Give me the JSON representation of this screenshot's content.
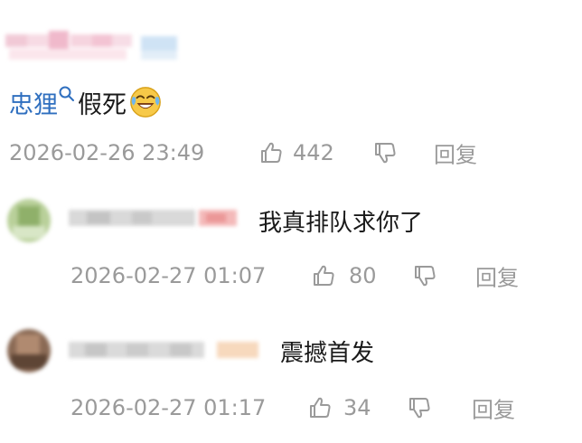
{
  "main_comment": {
    "mention": "忠狸",
    "text": "假死",
    "emoji_icon": "laughing-crying-face-icon",
    "timestamp": "2026-02-26 23:49",
    "likes": "442",
    "reply_label": "回复"
  },
  "replies": [
    {
      "text": "我真排队求你了",
      "timestamp": "2026-02-27 01:07",
      "likes": "80",
      "reply_label": "回复"
    },
    {
      "text": "震撼首发",
      "timestamp": "2026-02-27 01:17",
      "likes": "34",
      "reply_label": "回复"
    }
  ],
  "colors": {
    "mention": "#2f6fbf",
    "meta_gray": "#9a9a9a",
    "text": "#1a1a1a"
  },
  "icons": {
    "like": "thumbs-up-icon",
    "dislike": "thumbs-down-icon",
    "mention_mark": "at-mention-icon"
  }
}
